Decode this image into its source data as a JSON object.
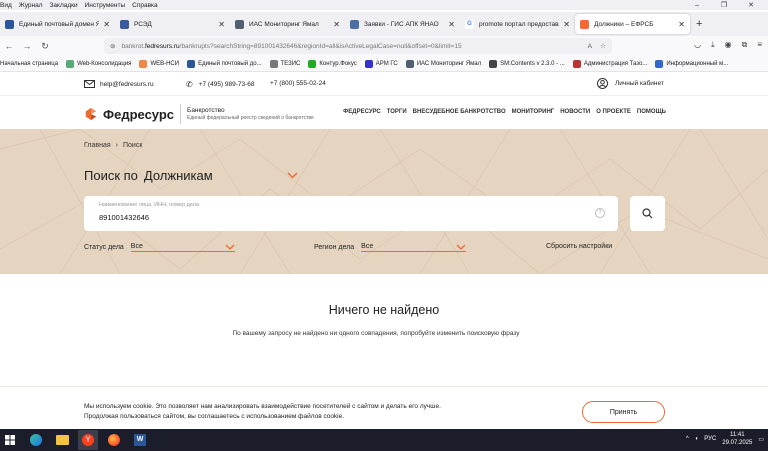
{
  "browser": {
    "menu": [
      "Вид",
      "Журнал",
      "Закладки",
      "Инструменты",
      "Справка"
    ],
    "tabs": [
      {
        "title": "Единый почтовый домен ЯНАО",
        "color": "#2b579a",
        "active": false
      },
      {
        "title": "РСЭД",
        "color": "#3a5ba0",
        "active": false
      },
      {
        "title": "ИАС Мониторинг Ямал",
        "color": "#506070",
        "active": false
      },
      {
        "title": "Заявки - ГИС АПК ЯНАО",
        "color": "#4a6fa5",
        "active": false
      },
      {
        "title": "promote портал предоставления",
        "color": "#4285f4",
        "active": false
      },
      {
        "title": "Должники – ЕФРСБ",
        "color": "#f06a34",
        "active": true
      }
    ],
    "url_prefix": "bankrot.",
    "url_domain": "fedresurs.ru",
    "url_rest": "/bankrupts?searchString=891001432646&regionId=all&isActiveLegalCase=null&offset=0&limit=15",
    "bookmarks": [
      {
        "label": "Начальная страница",
        "color": "#888"
      },
      {
        "label": "Web-Консолидация",
        "color": "#5a7"
      },
      {
        "label": "WEB-НСИ",
        "color": "#e84"
      },
      {
        "label": "Единый почтовый до...",
        "color": "#2b579a"
      },
      {
        "label": "ТЕЗИС",
        "color": "#777"
      },
      {
        "label": "Контур.Фокус",
        "color": "#2a2"
      },
      {
        "label": "АРМ ГС",
        "color": "#33c"
      },
      {
        "label": "ИАС Мониторинг Ямал",
        "color": "#506070"
      },
      {
        "label": "SM:Contents v 2.3.0 - ...",
        "color": "#444"
      },
      {
        "label": "Администрация Тазо...",
        "color": "#b33"
      },
      {
        "label": "Информационный м...",
        "color": "#36c"
      }
    ]
  },
  "site": {
    "email": "help@fedresurs.ru",
    "phone1": "+7 (495) 989-73-68",
    "phone2": "+7 (800) 555-02-24",
    "cabinet": "Личный кабинет",
    "logo_name": "Федресурс",
    "logo_sub1": "Банкротство",
    "logo_sub2": "Единый федеральный реестр сведений о банкротстве",
    "nav": [
      "ФЕДРЕСУРС",
      "ТОРГИ",
      "ВНЕСУДЕБНОЕ БАНКРОТСТВО",
      "МОНИТОРИНГ",
      "НОВОСТИ",
      "О ПРОЕКТЕ",
      "ПОМОЩЬ"
    ],
    "breadcrumb_home": "Главная",
    "breadcrumb_current": "Поиск",
    "search_prefix": "Поиск по",
    "search_mode": "Должникам",
    "search_label": "Наименование лица, ИНН, номер дела",
    "search_value": "891001432646",
    "status_label": "Статус дела",
    "status_value": "Все",
    "region_label": "Регион дела",
    "region_value": "Все",
    "reset": "Сбросить настройки",
    "result_title": "Ничего не найдено",
    "result_text": "По вашему запросу не найдено ни одного совпадения, попробуйте изменить поисковую фразу",
    "cookie_line1": "Мы используем cookie. Это позволяет нам анализировать взаимодействие посетителей с сайтом и делать его лучше.",
    "cookie_line2": "Продолжая пользоваться сайтом, вы соглашаетесь с использованием файлов cookie.",
    "cookie_accept": "Принять",
    "accent": "#f06a34",
    "hero_bg": "#e5d5c0"
  },
  "taskbar": {
    "lang": "РУС",
    "time": "11:41",
    "date": "29.07.2025"
  }
}
